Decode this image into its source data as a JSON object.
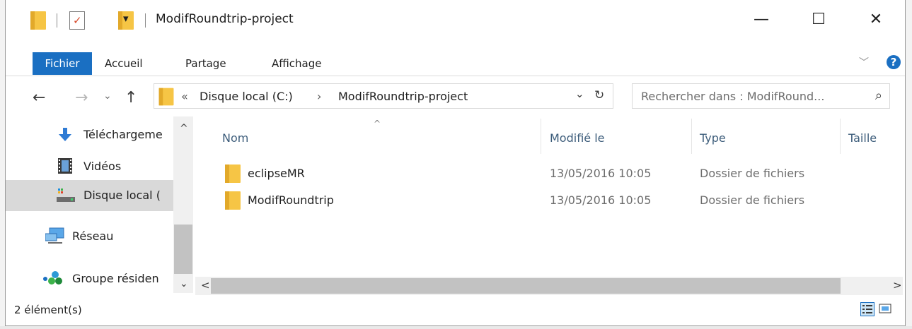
{
  "window": {
    "title": "ModifRoundtrip-project",
    "controls": {
      "minimize": "—",
      "maximize": "☐",
      "close": "✕"
    }
  },
  "quick_access": {
    "dropdown_glyph": "▾"
  },
  "ribbon": {
    "tabs": [
      "Fichier",
      "Accueil",
      "Partage",
      "Affichage"
    ],
    "expand_glyph": "﹀",
    "help_glyph": "?",
    "accent": "#1a6fc2"
  },
  "nav": {
    "back": "←",
    "forward": "→",
    "recent": "⌄",
    "up": "↑"
  },
  "address": {
    "overflow": "«",
    "crumbs": [
      "Disque local (C:)",
      "ModifRoundtrip-project"
    ],
    "separator": "›",
    "dropdown": "⌄",
    "refresh": "↻"
  },
  "search": {
    "placeholder": "Rechercher dans : ModifRound...",
    "icon": "⌕"
  },
  "nav_pane": {
    "items": [
      {
        "label": "Téléchargeme",
        "icon": "download-arrow-icon"
      },
      {
        "label": "Vidéos",
        "icon": "film-icon"
      },
      {
        "label": "Disque local (",
        "icon": "drive-icon",
        "selected": true
      },
      {
        "label": "Réseau",
        "icon": "network-icon"
      },
      {
        "label": "Groupe résiden",
        "icon": "homegroup-icon"
      }
    ],
    "scroll_up": "^",
    "scroll_down": "⌄"
  },
  "columns": [
    "Nom",
    "Modifié le",
    "Type",
    "Taille"
  ],
  "sort_glyph": "^",
  "files": [
    {
      "name": "eclipseMR",
      "modified": "13/05/2016 10:05",
      "type": "Dossier de fichiers"
    },
    {
      "name": "ModifRoundtrip",
      "modified": "13/05/2016 10:05",
      "type": "Dossier de fichiers"
    }
  ],
  "hscroll": {
    "left": "<",
    "right": ">"
  },
  "status": {
    "count": "2 élément(s)"
  }
}
